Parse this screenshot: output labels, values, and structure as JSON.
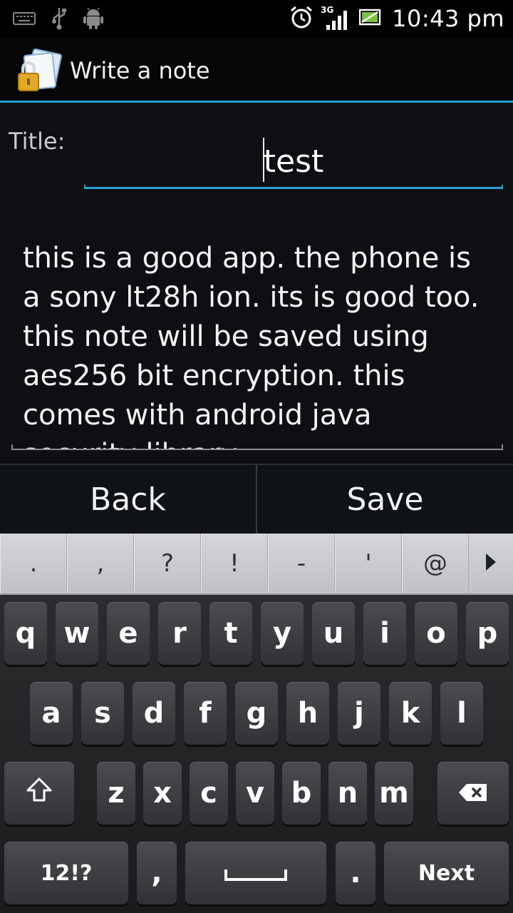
{
  "status_bar": {
    "time": "10:43 pm",
    "network_type": "3G",
    "left_icons": [
      "keyboard-icon",
      "usb-icon",
      "android-debug-icon"
    ],
    "right_icons": [
      "alarm-clock-icon",
      "signal-icon",
      "battery-charging-icon"
    ]
  },
  "action_bar": {
    "title": "Write a note",
    "icon": "notes-lock-icon"
  },
  "form": {
    "title_label": "Title:",
    "title_value": "test",
    "body_text": "this is a good app. the phone is a sony lt28h ion. its is good too. this note will be saved using aes256 bit encryption. this comes with android java security library."
  },
  "buttons": {
    "back_label": "Back",
    "save_label": "Save"
  },
  "suggestions": [
    ".",
    ",",
    "?",
    "!",
    "-",
    "'",
    "@"
  ],
  "keyboard": {
    "row1": [
      "q",
      "w",
      "e",
      "r",
      "t",
      "y",
      "u",
      "i",
      "o",
      "p"
    ],
    "row2": [
      "a",
      "s",
      "d",
      "f",
      "g",
      "h",
      "j",
      "k",
      "l"
    ],
    "row3": [
      "z",
      "x",
      "c",
      "v",
      "b",
      "n",
      "m"
    ],
    "symbols_label": "12!?",
    "comma_label": ",",
    "period_label": ".",
    "next_label": "Next"
  },
  "colors": {
    "accent": "#2a9fd6",
    "background": "#0d0f13",
    "key": "#3d3f42"
  }
}
